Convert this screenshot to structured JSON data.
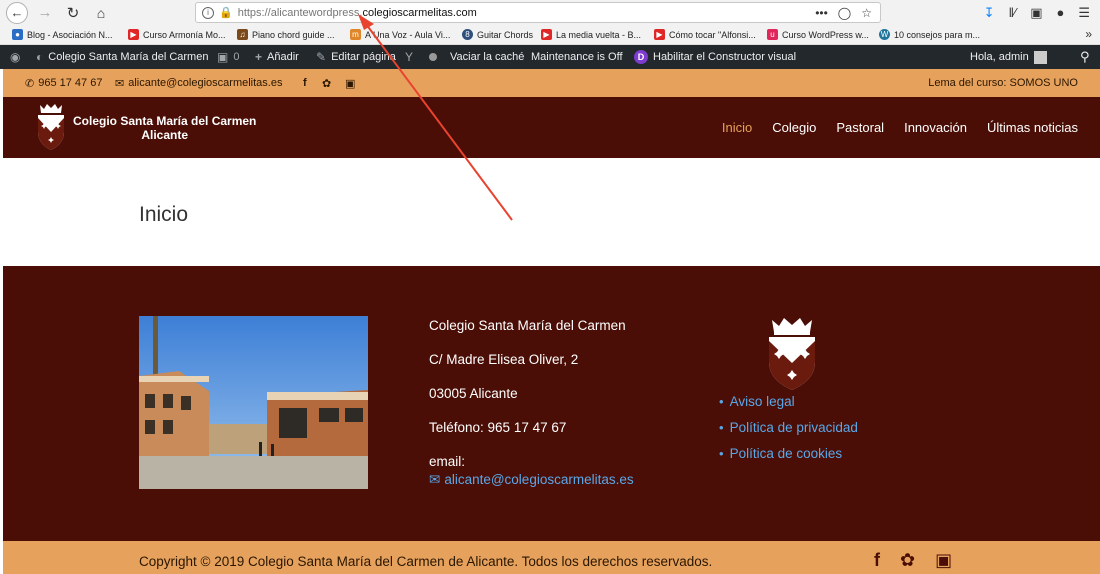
{
  "browser": {
    "url_scheme": "https://",
    "url_sub": "alicantewordpress.",
    "url_domain": "colegioscarmelitas.com",
    "url_more": "•••"
  },
  "bookmarks": [
    {
      "label": "Blog - Asociación N...",
      "color": "#2a6dc4",
      "icon": "asociacion-icon"
    },
    {
      "label": "Curso Armonía Mo...",
      "color": "#e02727",
      "icon": "youtube-icon"
    },
    {
      "label": "Piano chord guide ...",
      "color": "#7a4a1a",
      "icon": "piano-icon"
    },
    {
      "label": "A Una Voz - Aula Vi...",
      "color": "#e0862a",
      "icon": "moodle-icon"
    },
    {
      "label": "Guitar Chords",
      "color": "#2d4f7c",
      "icon": "guitar-icon"
    },
    {
      "label": "La media vuelta - B...",
      "color": "#e02727",
      "icon": "youtube-icon"
    },
    {
      "label": "Cómo tocar \"Alfonsi...",
      "color": "#e02727",
      "icon": "youtube-icon"
    },
    {
      "label": "Curso WordPress w...",
      "color": "#e0265a",
      "icon": "udemy-icon"
    },
    {
      "label": "10 consejos para m...",
      "color": "#21759b",
      "icon": "wordpress-icon"
    }
  ],
  "wp_admin": {
    "site": "Colegio Santa María del Carmen",
    "comments": "0",
    "add": "Añadir",
    "edit": "Editar página",
    "cache": "Vaciar la caché",
    "maintenance": "Maintenance is Off",
    "divi": "Habilitar el Constructor visual",
    "greeting": "Hola, admin"
  },
  "topbar": {
    "phone": "965 17 47 67",
    "email": "alicante@colegioscarmelitas.es",
    "motto": "Lema del curso: SOMOS UNO"
  },
  "header": {
    "site_line1": "Colegio Santa María del Carmen",
    "site_line2": "Alicante",
    "nav": [
      "Inicio",
      "Colegio",
      "Pastoral",
      "Innovación",
      "Últimas noticias"
    ]
  },
  "page": {
    "title": "Inicio"
  },
  "footer": {
    "name": "Colegio Santa María del Carmen",
    "address": "C/ Madre Elisea Oliver, 2",
    "city": "03005 Alicante",
    "phone": "Teléfono: 965 17 47 67",
    "email_label": "email:",
    "email": "alicante@colegioscarmelitas.es",
    "links": [
      "Aviso legal",
      "Política de privacidad",
      "Política de cookies"
    ]
  },
  "copyright": "Copyright © 2019 Colegio Santa María del Carmen de Alicante. Todos los derechos reservados.",
  "colors": {
    "brand_dark": "#4a0e06",
    "brand_orange": "#e6a25c",
    "link_blue": "#5aa7e8",
    "annotation_red": "#e8432e"
  }
}
